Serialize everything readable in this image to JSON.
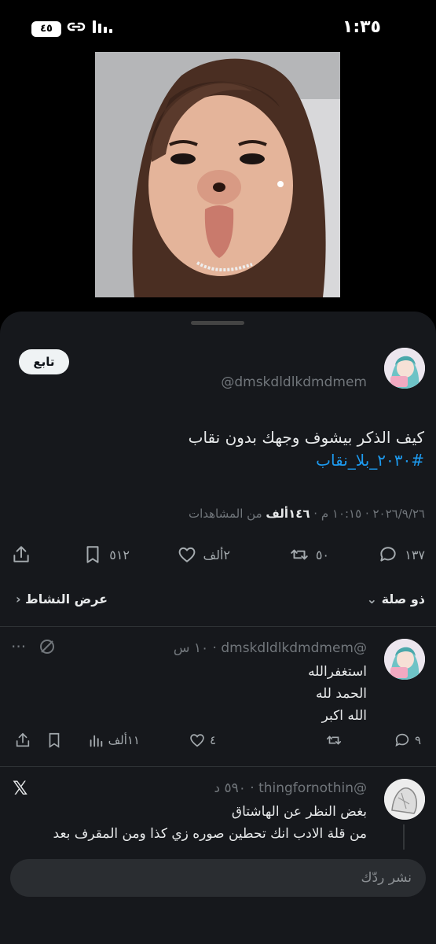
{
  "status_bar": {
    "time": "١:٣٥",
    "battery": "٤٥"
  },
  "tweet": {
    "follow_label": "تابع",
    "handle": "@dmskdldlkdmdmem",
    "text": "كيف الذكر بيشوف وجهك بدون نقاب",
    "hashtag": "#٢٠٣٠_بلا_نقاب",
    "date_time": "٢٠٢٦/٩/٢٦ · ١٠:١٥ م · ",
    "views_value": "١٤٦ألف",
    "views_label": " من المشاهدات",
    "actions": {
      "replies": "١٣٧",
      "reposts": "٥٠",
      "likes": "٢ألف",
      "bookmarks": "٥١٢"
    }
  },
  "sort": {
    "label": "ذو صلة",
    "activity_label": "عرض النشاط"
  },
  "replies": [
    {
      "handle": "@dmskdldlkdmdmem",
      "time": "١٠ س",
      "lines": [
        "استغفرالله",
        "الحمد لله",
        "الله اكبر"
      ],
      "actions": {
        "replies": "٩",
        "reposts": "",
        "likes": "٤",
        "views": "١١ألف"
      }
    },
    {
      "handle": "@thingfornothin",
      "time": "٥٩٠ د",
      "lines": [
        "بغض النظر عن الهاشتاق",
        "من قلة الادب انك تحطين صوره زي كذا ومن المقرف بعد"
      ]
    }
  ],
  "compose": {
    "placeholder": "نشر ردّك"
  },
  "colors": {
    "accent": "#1d9bf0",
    "background": "#000000",
    "sheet": "#16181c"
  }
}
